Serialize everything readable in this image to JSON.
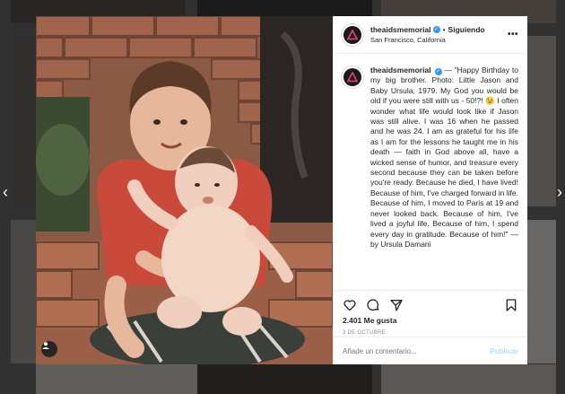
{
  "post": {
    "username": "theaidsmemorial",
    "follow_status": "Siguiendo",
    "location": "San Francisco, California",
    "caption": "— \"Happy Birthday to my big brother. Photo: Little Jason and Baby Ursula, 1979. My God you would be old if you were still with us - 50!?! 😉 I often wonder what life would look like if Jason was still alive. I was 16 when he passed and he was 24. I am as grateful for his life as I am for the lessons he taught me in his death — faith in God above all, have a wicked sense of humor, and treasure every second because they can be taken before you're ready. Because he died, I have lived! Because of him, I've charged forward in life. Because of him, I moved to Paris at 19 and never looked back. Because of him, I've lived a joyful life. Because of him, I spend every day in gratitude. Because of him!\" — by Ursula Damani",
    "likes": "2.401 Me gusta",
    "date": "3 DE OCTUBRE",
    "comment_placeholder": "Añade un comentario...",
    "publish_label": "Publicar",
    "more_label": "•••",
    "dot": "•"
  },
  "nav": {
    "prev": "‹",
    "next": "›"
  },
  "icons": [
    "heart-icon",
    "comment-icon",
    "share-icon",
    "bookmark-icon",
    "more-options-icon",
    "user-tag-icon",
    "verified-badge-icon"
  ],
  "colors": {
    "link_blue": "#3897f0",
    "publish_disabled": "#b2dffc",
    "border": "#efefef",
    "muted": "#8e8e8e"
  }
}
